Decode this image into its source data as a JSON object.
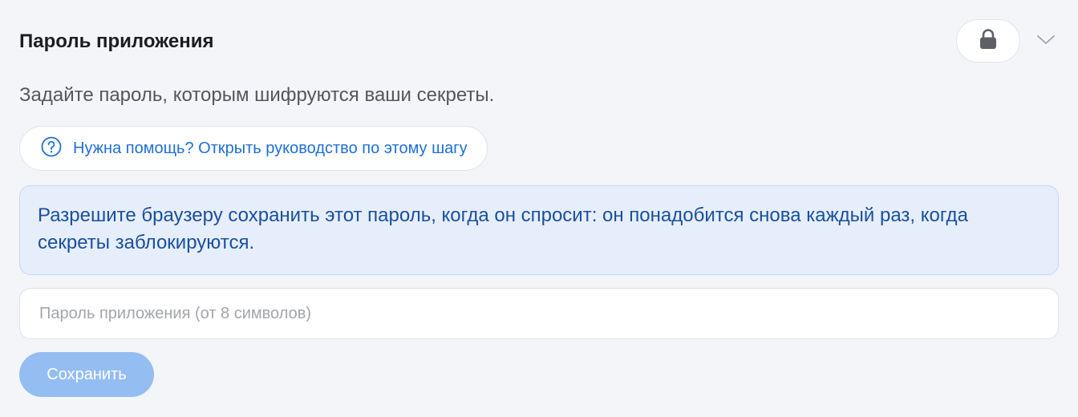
{
  "section": {
    "title": "Пароль приложения",
    "description": "Задайте пароль, которым шифруются ваши секреты.",
    "lock_icon": "lock-icon",
    "collapse_icon": "chevron-down-icon"
  },
  "help": {
    "icon": "question-circle-icon",
    "label": "Нужна помощь? Открыть руководство по этому шагу"
  },
  "notice": {
    "text": "Разрешите браузеру сохранить этот пароль, когда он спросит: он понадобится снова каждый раз, когда секреты заблокируются."
  },
  "password_field": {
    "value": "",
    "placeholder": "Пароль приложения (от 8 символов)"
  },
  "actions": {
    "save_label": "Сохранить",
    "save_disabled": true
  },
  "colors": {
    "accent": "#1f6fd1",
    "notice_bg": "#e6eefb",
    "notice_text": "#1a4f9c",
    "button_disabled": "#94bdf2"
  }
}
